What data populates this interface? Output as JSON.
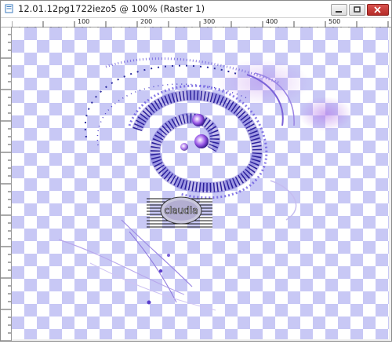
{
  "window": {
    "title": "12.01.12pg1722iezo5 @ 100% (Raster 1)",
    "buttons": [
      "minimize",
      "maximize",
      "close"
    ]
  },
  "ruler": {
    "top_labels": [
      "100",
      "200",
      "300",
      "400",
      "500"
    ]
  },
  "canvas": {
    "watermark_text": "claudia",
    "checker_color": "#c8c8f5",
    "art_color": "#4b3fc9",
    "glow_color": "#9b59e8"
  }
}
